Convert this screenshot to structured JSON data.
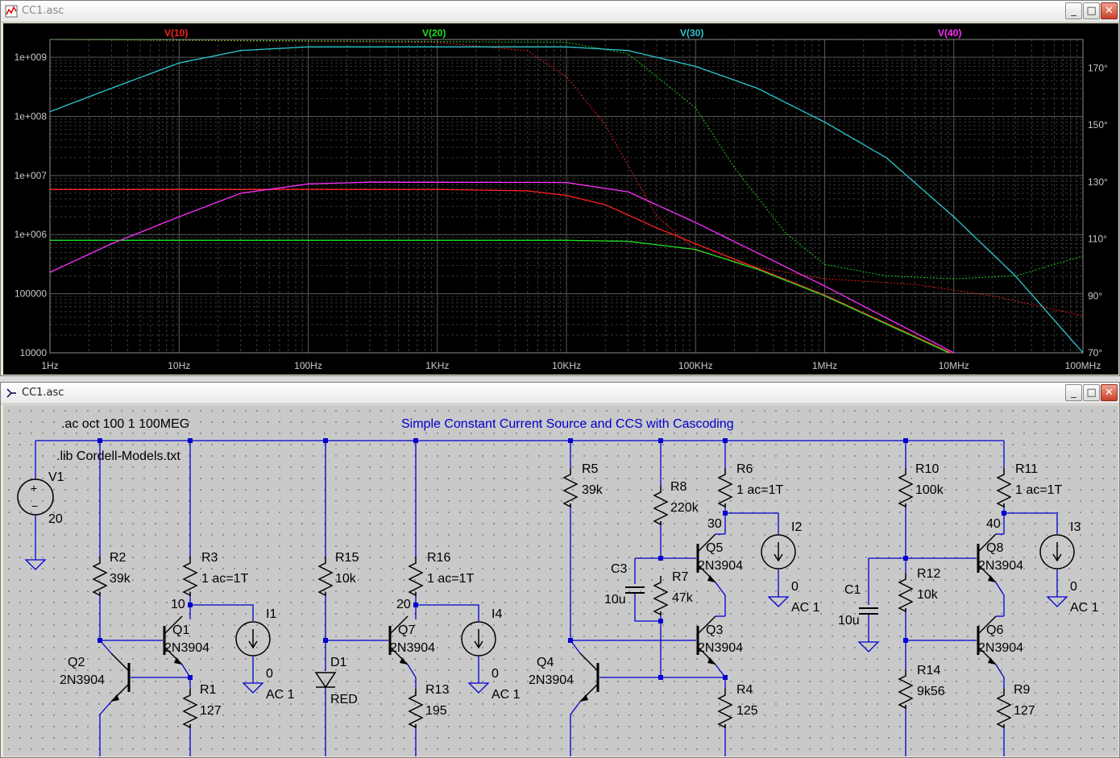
{
  "plot_window": {
    "title": "CC1.asc",
    "icon": "waveform-icon",
    "buttons": {
      "minimize": "_",
      "maximize": "□",
      "close": "✕"
    }
  },
  "schematic_window": {
    "title": "CC1.asc",
    "icon": "schematic-icon",
    "buttons": {
      "minimize": "_",
      "maximize": "□",
      "close": "✕"
    }
  },
  "chart_data": {
    "type": "line",
    "title": "",
    "xscale": "log",
    "xlim": [
      1,
      100000000
    ],
    "x_ticks": [
      "1Hz",
      "10Hz",
      "100Hz",
      "1KHz",
      "10KHz",
      "100KHz",
      "1MHz",
      "10MHz",
      "100MHz"
    ],
    "y_left_scale": "log",
    "y_left_lim": [
      10000,
      2000000000
    ],
    "y_left_ticks": [
      "1e+009",
      "1e+008",
      "1e+007",
      "1e+006",
      "100000",
      "10000"
    ],
    "y_right_lim": [
      70,
      180
    ],
    "y_right_ticks": [
      "170°",
      "150°",
      "130°",
      "110°",
      "90°",
      "70°"
    ],
    "grid": true,
    "legend_position": "top",
    "series": [
      {
        "name": "V(10)",
        "color": "#ff2020",
        "magnitude": [
          [
            1,
            5800000
          ],
          [
            1000,
            5800000
          ],
          [
            5000,
            5500000
          ],
          [
            10000,
            4600000
          ],
          [
            20000,
            3200000
          ],
          [
            50000,
            1300000
          ],
          [
            100000,
            700000
          ],
          [
            1000000,
            95000
          ],
          [
            10000000,
            9500
          ]
        ],
        "phase": [
          [
            1,
            180
          ],
          [
            1000,
            179
          ],
          [
            5000,
            176
          ],
          [
            10000,
            167
          ],
          [
            20000,
            150
          ],
          [
            50000,
            118
          ],
          [
            100000,
            106
          ],
          [
            300000,
            100
          ],
          [
            1000000,
            96
          ],
          [
            5000000,
            94
          ],
          [
            20000000,
            90
          ],
          [
            100000000,
            83
          ]
        ]
      },
      {
        "name": "V(20)",
        "color": "#20e020",
        "magnitude": [
          [
            1,
            800000
          ],
          [
            10000,
            800000
          ],
          [
            30000,
            770000
          ],
          [
            100000,
            560000
          ],
          [
            300000,
            260000
          ],
          [
            1000000,
            92000
          ],
          [
            10000000,
            9200
          ]
        ],
        "phase": [
          [
            1,
            180
          ],
          [
            10000,
            179
          ],
          [
            30000,
            175
          ],
          [
            100000,
            156
          ],
          [
            200000,
            135
          ],
          [
            500000,
            112
          ],
          [
            1000000,
            101
          ],
          [
            3000000,
            97
          ],
          [
            10000000,
            96
          ],
          [
            30000000,
            97
          ],
          [
            100000000,
            104
          ]
        ]
      },
      {
        "name": "V(30)",
        "color": "#2ec8d0",
        "magnitude": [
          [
            1,
            120000000
          ],
          [
            3,
            300000000
          ],
          [
            10,
            800000000
          ],
          [
            30,
            1300000000
          ],
          [
            100,
            1500000000
          ],
          [
            10000,
            1500000000
          ],
          [
            30000,
            1300000000
          ],
          [
            100000,
            700000000
          ],
          [
            300000,
            300000000
          ],
          [
            1000000,
            80000000
          ],
          [
            3000000,
            20000000
          ],
          [
            10000000,
            2000000
          ],
          [
            30000000,
            200000
          ],
          [
            100000000,
            10000
          ]
        ]
      },
      {
        "name": "V(40)",
        "color": "#ff30ff",
        "magnitude": [
          [
            1,
            230000
          ],
          [
            3,
            700000
          ],
          [
            10,
            2000000
          ],
          [
            30,
            5000000
          ],
          [
            100,
            7200000
          ],
          [
            300,
            7700000
          ],
          [
            10000,
            7600000
          ],
          [
            30000,
            5300000
          ],
          [
            100000,
            1600000
          ],
          [
            1000000,
            135000
          ],
          [
            10000000,
            10000
          ]
        ]
      }
    ]
  },
  "schematic": {
    "directives": [
      ".ac oct 100 1 100MEG",
      ".lib Cordell-Models.txt"
    ],
    "title_comment": "Simple Constant Current Source  and CCS with Cascoding",
    "wire_color": "#0000d0",
    "components": [
      {
        "ref": "V1",
        "value": "20"
      },
      {
        "ref": "R2",
        "value": "39k"
      },
      {
        "ref": "R3",
        "value": "1 ac=1T"
      },
      {
        "ref": "Q1",
        "value": "2N3904"
      },
      {
        "ref": "Q2",
        "value": "2N3904"
      },
      {
        "ref": "R1",
        "value": "127"
      },
      {
        "ref": "I1",
        "value": "0",
        "ac": "AC 1"
      },
      {
        "ref": "R15",
        "value": "10k"
      },
      {
        "ref": "D1",
        "value": "RED"
      },
      {
        "ref": "R16",
        "value": "1 ac=1T"
      },
      {
        "ref": "Q7",
        "value": "2N3904"
      },
      {
        "ref": "R13",
        "value": "195"
      },
      {
        "ref": "I4",
        "value": "0",
        "ac": "AC 1"
      },
      {
        "ref": "R5",
        "value": "39k"
      },
      {
        "ref": "Q4",
        "value": "2N3904"
      },
      {
        "ref": "R8",
        "value": "220k"
      },
      {
        "ref": "C3",
        "value": "10u"
      },
      {
        "ref": "R7",
        "value": "47k"
      },
      {
        "ref": "R6",
        "value": "1 ac=1T"
      },
      {
        "ref": "Q5",
        "value": "2N3904"
      },
      {
        "ref": "Q3",
        "value": "2N3904"
      },
      {
        "ref": "R4",
        "value": "125"
      },
      {
        "ref": "I2",
        "value": "0",
        "ac": "AC 1"
      },
      {
        "ref": "R10",
        "value": "100k"
      },
      {
        "ref": "C1",
        "value": "10u"
      },
      {
        "ref": "R12",
        "value": "10k"
      },
      {
        "ref": "R14",
        "value": "9k56"
      },
      {
        "ref": "R11",
        "value": "1 ac=1T"
      },
      {
        "ref": "Q8",
        "value": "2N3904"
      },
      {
        "ref": "Q6",
        "value": "2N3904"
      },
      {
        "ref": "R9",
        "value": "127"
      },
      {
        "ref": "I3",
        "value": "0",
        "ac": "AC 1"
      }
    ],
    "net_labels": [
      "10",
      "20",
      "30",
      "40"
    ]
  }
}
